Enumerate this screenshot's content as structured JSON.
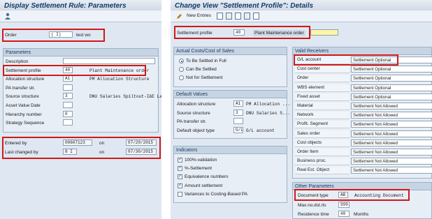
{
  "left": {
    "title": "Display Settlement Rule: Parameters",
    "toolbar_icon": "person-icon",
    "order_label": "Order",
    "order_value": "( I)",
    "order_text": "test wo",
    "params_header": "Parameters",
    "rows": [
      {
        "label": "Description",
        "value": "",
        "text": ""
      },
      {
        "label": "Settlement profile",
        "value": "40",
        "text": "Plant Maintenance order"
      },
      {
        "label": "Allocation structure",
        "value": "A1",
        "text": "PM Allocation Structure"
      },
      {
        "label": "PA transfer str.",
        "value": "",
        "text": ""
      },
      {
        "label": "Source structure",
        "value": "3",
        "text": "DNU Salaries Spiltout-I&E Lab"
      },
      {
        "label": "Asset Value Date",
        "value": "",
        "text": ""
      },
      {
        "label": "Hierarchy number",
        "value": "0",
        "text": ""
      },
      {
        "label": "Strategy Sequence",
        "value": "",
        "text": ""
      }
    ],
    "entered_by_label": "Entered by",
    "entered_by_value": "00607123",
    "entered_on_label": "on",
    "entered_on_value": "07/20/2015",
    "changed_by_label": "Last changed by",
    "changed_by_value": "8 I",
    "changed_on_label": "on",
    "changed_on_value": "07/30/2015"
  },
  "right": {
    "title": "Change View \"Settlement Profile\": Details",
    "new_entries": "New Entries",
    "profile_label": "Settlement profile",
    "profile_value": "40",
    "profile_text": "Plant Maintenance order",
    "actual_costs": {
      "header": "Actual Costs/Cost of Sales",
      "options": [
        {
          "label": "To Be Settled in Full",
          "selected": true
        },
        {
          "label": "Can Be Settled",
          "selected": false
        },
        {
          "label": "Not for Settlement",
          "selected": false
        }
      ]
    },
    "default_values": {
      "header": "Default Values",
      "rows": [
        {
          "label": "Allocation structure",
          "value": "A1",
          "text": "PM Allocation ..."
        },
        {
          "label": "Source structure",
          "value": "3",
          "text": "DNU Salaries S..."
        },
        {
          "label": "PA transfer str.",
          "value": "",
          "text": ""
        },
        {
          "label": "Default object type",
          "value": "G/L",
          "text": "G/L account"
        }
      ]
    },
    "indicators": {
      "header": "Indicators",
      "items": [
        {
          "label": "100%-validation",
          "checked": true
        },
        {
          "label": "%-Settlement",
          "checked": true
        },
        {
          "label": "Equivalence numbers",
          "checked": true
        },
        {
          "label": "Amount settlement",
          "checked": true
        },
        {
          "label": "Variances to Costing-Based PA",
          "checked": false
        }
      ]
    },
    "valid_receivers": {
      "header": "Valid Receivers",
      "rows": [
        {
          "label": "G/L account",
          "value": "Settlement Optional"
        },
        {
          "label": "Cost center",
          "value": "Settlement Optional"
        },
        {
          "label": "Order",
          "value": "Settlement Optional"
        },
        {
          "label": "WBS element",
          "value": "Settlement Optional"
        },
        {
          "label": "Fixed asset",
          "value": "Settlement Optional"
        },
        {
          "label": "Material",
          "value": "Settlement Not Allowed"
        },
        {
          "label": "Network",
          "value": "Settlement Not Allowed"
        },
        {
          "label": "Profit. Segment",
          "value": "Settlement Not Allowed"
        },
        {
          "label": "Sales order",
          "value": "Settlement Not Allowed"
        },
        {
          "label": "Cost objects",
          "value": "Settlement Not Allowed"
        },
        {
          "label": "Order Item",
          "value": "Settlement Not Allowed"
        },
        {
          "label": "Business proc.",
          "value": "Settlement Not Allowed"
        },
        {
          "label": "Real Est. Object",
          "value": "Settlement Not Allowed"
        }
      ]
    },
    "other_params": {
      "header": "Other Parameters",
      "doc_type_label": "Document type",
      "doc_type_value": "AB",
      "doc_type_text": "Accounting Document",
      "max_label": "Max.no.dst.rls",
      "max_value": "999",
      "residence_label": "Residence time",
      "residence_value": "40",
      "residence_unit": "Months"
    }
  },
  "colors": {
    "highlight": "#d01818",
    "title": "#123a66",
    "field_yellow": "#fff3a6",
    "selected_text": "#cfd9e6"
  }
}
